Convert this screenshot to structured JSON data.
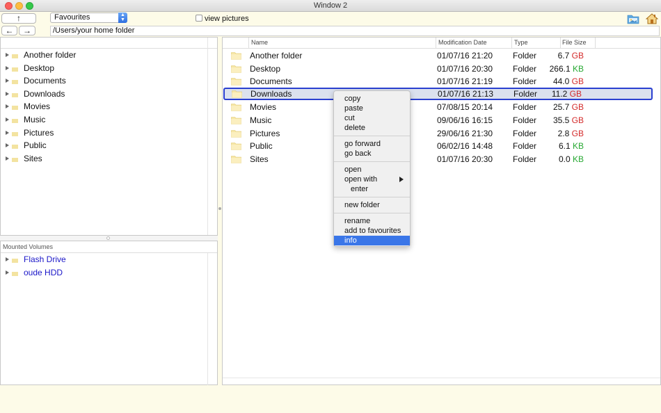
{
  "window": {
    "title": "Window 2"
  },
  "toolbar": {
    "up_glyph": "↑",
    "back_glyph": "←",
    "forward_glyph": "→",
    "favourites_selected": "Favourites",
    "view_pictures_label": "view pictures",
    "view_pictures_checked": false,
    "path": "/Users/your home folder"
  },
  "tree": {
    "items": [
      {
        "label": "Another folder"
      },
      {
        "label": "Desktop"
      },
      {
        "label": "Documents"
      },
      {
        "label": "Downloads"
      },
      {
        "label": "Movies"
      },
      {
        "label": "Music"
      },
      {
        "label": "Pictures"
      },
      {
        "label": "Public"
      },
      {
        "label": "Sites"
      }
    ]
  },
  "volumes": {
    "header": "Mounted Volumes",
    "items": [
      {
        "label": "Flash Drive"
      },
      {
        "label": "oude HDD"
      }
    ]
  },
  "file_list": {
    "columns": [
      "Name",
      "Modification Date",
      "Type",
      "File Size"
    ],
    "rows": [
      {
        "name": "Another folder",
        "date": "01/07/16 21:20",
        "type": "Folder",
        "size": "6.7",
        "unit": "GB"
      },
      {
        "name": "Desktop",
        "date": "01/07/16 20:30",
        "type": "Folder",
        "size": "266.1",
        "unit": "KB"
      },
      {
        "name": "Documents",
        "date": "01/07/16 21:19",
        "type": "Folder",
        "size": "44.0",
        "unit": "GB"
      },
      {
        "name": "Downloads",
        "date": "01/07/16 21:13",
        "type": "Folder",
        "size": "11.2",
        "unit": "GB"
      },
      {
        "name": "Movies",
        "date": "07/08/15 20:14",
        "type": "Folder",
        "size": "25.7",
        "unit": "GB"
      },
      {
        "name": "Music",
        "date": "09/06/16 16:15",
        "type": "Folder",
        "size": "35.5",
        "unit": "GB"
      },
      {
        "name": "Pictures",
        "date": "29/06/16 21:30",
        "type": "Folder",
        "size": "2.8",
        "unit": "GB"
      },
      {
        "name": "Public",
        "date": "06/02/16 14:48",
        "type": "Folder",
        "size": "6.1",
        "unit": "KB"
      },
      {
        "name": "Sites",
        "date": "01/07/16 20:30",
        "type": "Folder",
        "size": "0.0",
        "unit": "KB"
      }
    ],
    "selected_row": "Downloads"
  },
  "context_menu": {
    "copy": "copy",
    "paste": "paste",
    "cut": "cut",
    "delete": "delete",
    "go_forward": "go forward",
    "go_back": "go back",
    "open": "open",
    "open_with": "open with",
    "enter": "enter",
    "new_folder": "new folder",
    "rename": "rename",
    "add_to_favourites": "add to favourites",
    "info": "info",
    "highlighted": "info"
  },
  "colors": {
    "gb_unit": "#d42a2a",
    "kb_unit": "#26a832",
    "selection_border": "#2a3fd0",
    "menu_highlight": "#3a76e8",
    "volume_link": "#1a16c8"
  },
  "icons": {
    "folder": "folder-icon",
    "pictures": "pictures-folder-icon",
    "home": "home-icon"
  }
}
